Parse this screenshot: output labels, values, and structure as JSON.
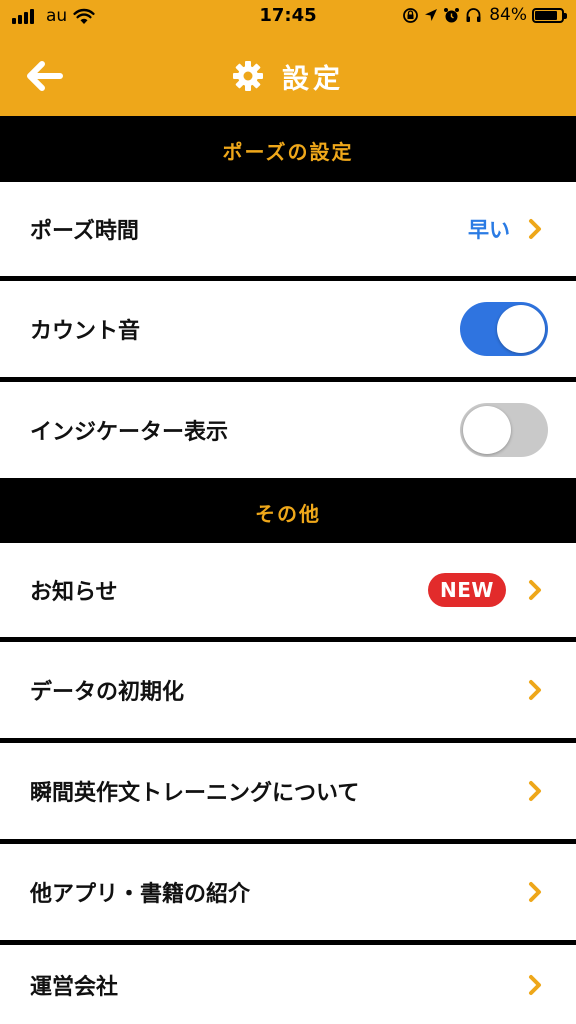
{
  "status_bar": {
    "carrier": "au",
    "time": "17:45",
    "battery_percent": "84%",
    "battery_level": 0.84,
    "icons": [
      "signal-icon",
      "wifi-icon",
      "rotation-lock-icon",
      "location-icon",
      "alarm-icon",
      "headphones-icon",
      "battery-icon"
    ]
  },
  "nav": {
    "title": "設定",
    "back_icon": "arrow-left-icon",
    "title_icon": "gear-icon"
  },
  "colors": {
    "accent": "#eea71a",
    "toggle_on": "#2f74e0",
    "toggle_off": "#c9c9c9",
    "badge": "#e22b2b",
    "value_text": "#2a7be4"
  },
  "sections": [
    {
      "title": "ポーズの設定",
      "rows": [
        {
          "label": "ポーズ時間",
          "value": "早い",
          "type": "disclosure"
        },
        {
          "label": "カウント音",
          "type": "toggle",
          "on": true
        },
        {
          "label": "インジケーター表示",
          "type": "toggle",
          "on": false
        }
      ]
    },
    {
      "title": "その他",
      "rows": [
        {
          "label": "お知らせ",
          "badge": "NEW",
          "type": "disclosure"
        },
        {
          "label": "データの初期化",
          "type": "disclosure"
        },
        {
          "label": "瞬間英作文トレーニングについて",
          "type": "disclosure"
        },
        {
          "label": "他アプリ・書籍の紹介",
          "type": "disclosure"
        },
        {
          "label": "運営会社",
          "type": "disclosure"
        }
      ]
    }
  ]
}
